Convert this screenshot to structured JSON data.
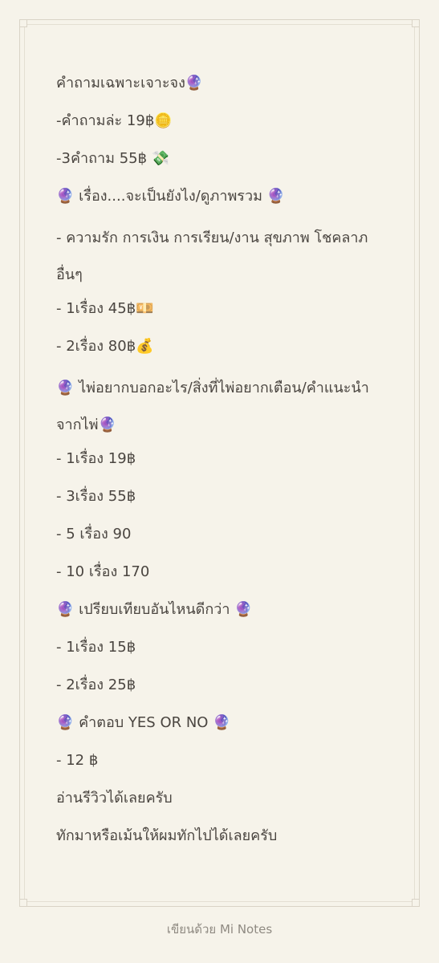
{
  "note": {
    "lines": [
      "คำถามเฉพาะเจาะจง🔮",
      "-คำถามล่ะ 19฿🪙",
      "-3คำถาม 55฿ 💸",
      "🔮 เรื่อง....จะเป็นยังไง/ดูภาพรวม 🔮",
      "- ความรัก การเงิน การเรียน/งาน สุขภาพ โชคลาภ อื่นๆ",
      "- 1เรื่อง 45฿💴",
      "- 2เรื่อง 80฿💰",
      "🔮 ไพ่อยากบอกอะไร/สิ่งที่ไพ่อยากเตือน/คำแนะนำจากไพ่🔮",
      "- 1เรื่อง 19฿",
      "- 3เรื่อง 55฿",
      "- 5 เรื่อง 90",
      "- 10 เรื่อง 170",
      "🔮 เปรียบเทียบอันไหนดีกว่า 🔮",
      "- 1เรื่อง 15฿",
      "- 2เรื่อง 25฿",
      "🔮 คำตอบ YES OR NO 🔮",
      "- 12 ฿",
      "อ่านรีวิวได้เลยครับ",
      "ทักมาหรือเม้นให้ผมทักไปได้เลยครับ"
    ]
  },
  "footer": {
    "text": "เขียนด้วย Mi Notes"
  }
}
